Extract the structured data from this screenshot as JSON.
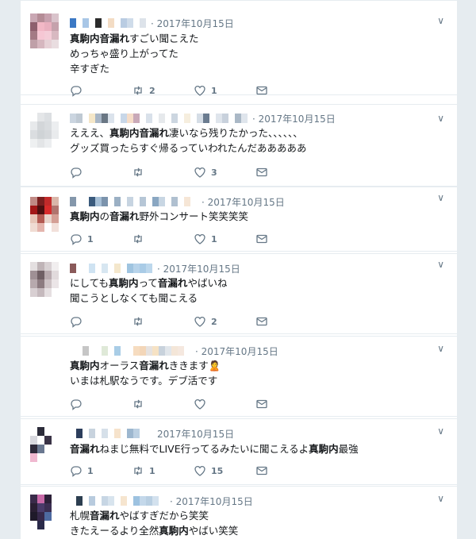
{
  "tweets": [
    {
      "date": "· 2017年10月15日",
      "lines": [
        [
          {
            "b": true,
            "t": "真駒内音漏れ"
          },
          {
            "b": false,
            "t": "すごい聞こえた"
          }
        ],
        [
          {
            "b": false,
            "t": "めっちゃ盛り上がってた"
          }
        ],
        [
          {
            "b": false,
            "t": "辛すぎた"
          }
        ]
      ],
      "reply": "",
      "retweet": "2",
      "like": "1"
    },
    {
      "date": "· 2017年10月15日",
      "lines": [
        [
          {
            "b": false,
            "t": "えええ、"
          },
          {
            "b": true,
            "t": "真駒内音漏れ"
          },
          {
            "b": false,
            "t": "凄いなら残りたかった、、、、、、"
          }
        ],
        [
          {
            "b": false,
            "t": "グッズ買ったらすぐ帰るっていわれたんだあああああ"
          }
        ]
      ],
      "reply": "",
      "retweet": "",
      "like": "3"
    },
    {
      "date": "· 2017年10月15日",
      "lines": [
        [
          {
            "b": true,
            "t": "真駒内"
          },
          {
            "b": false,
            "t": "の"
          },
          {
            "b": true,
            "t": "音漏れ"
          },
          {
            "b": false,
            "t": "野外コンサート笑笑笑笑"
          }
        ]
      ],
      "reply": "1",
      "retweet": "",
      "like": "1"
    },
    {
      "date": "· 2017年10月15日",
      "lines": [
        [
          {
            "b": false,
            "t": "にしても"
          },
          {
            "b": true,
            "t": "真駒内"
          },
          {
            "b": false,
            "t": "って"
          },
          {
            "b": true,
            "t": "音漏れ"
          },
          {
            "b": false,
            "t": "やばいね"
          }
        ],
        [
          {
            "b": false,
            "t": "聞こうとしなくても聞こえる"
          }
        ]
      ],
      "reply": "",
      "retweet": "",
      "like": "2"
    },
    {
      "date": "· 2017年10月15日",
      "lines": [
        [
          {
            "b": true,
            "t": "真駒内"
          },
          {
            "b": false,
            "t": "オーラス"
          },
          {
            "b": true,
            "t": "音漏れ"
          },
          {
            "b": false,
            "t": "ききます🙎"
          }
        ],
        [
          {
            "b": false,
            "t": "いまは札駅なうです。デブ活です"
          }
        ]
      ],
      "reply": "",
      "retweet": "",
      "like": ""
    },
    {
      "date": "2017年10月15日",
      "lines": [
        [
          {
            "b": true,
            "t": "音漏れ"
          },
          {
            "b": false,
            "t": "ねまじ無料でLIVE行ってるみたいに聞こえるよ"
          },
          {
            "b": true,
            "t": "真駒内"
          },
          {
            "b": false,
            "t": "最強"
          }
        ]
      ],
      "reply": "1",
      "retweet": "1",
      "like": "15"
    },
    {
      "date": "· 2017年10月15日",
      "lines": [
        [
          {
            "b": false,
            "t": "札幌"
          },
          {
            "b": true,
            "t": "音漏れ"
          },
          {
            "b": false,
            "t": "やばすぎだから笑笑"
          }
        ],
        [
          {
            "b": false,
            "t": "きたえーるより全然"
          },
          {
            "b": true,
            "t": "真駒内"
          },
          {
            "b": false,
            "t": "やばい笑笑"
          }
        ]
      ],
      "reply": "",
      "retweet": "",
      "like": ""
    }
  ],
  "icons": {
    "reply": "reply-icon",
    "retweet": "retweet-icon",
    "like": "like-icon",
    "dm": "message-icon",
    "caret": "chevron-down-icon"
  },
  "colors": {
    "muted": "#657786",
    "text": "#14171a",
    "border": "#e6ecf0",
    "bg": "#e6ecf0"
  }
}
